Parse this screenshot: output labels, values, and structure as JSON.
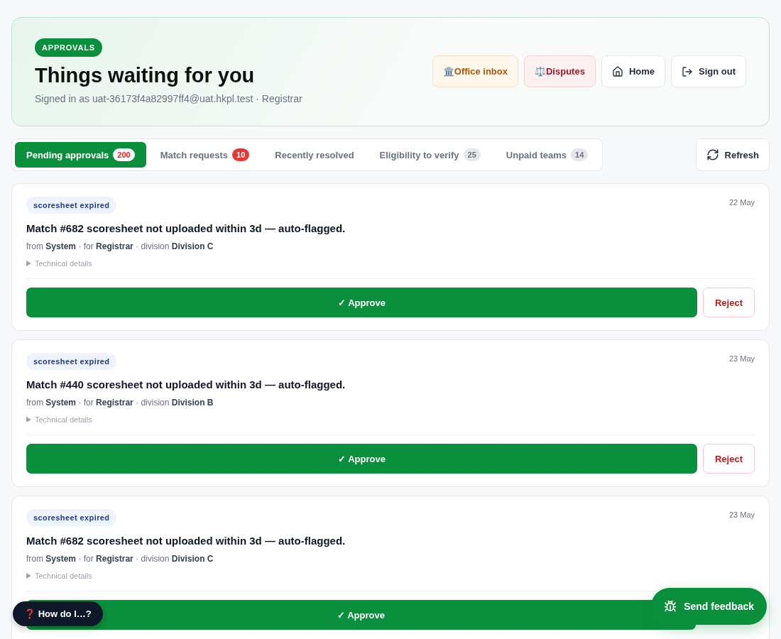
{
  "header": {
    "badge": "APPROVALS",
    "title": "Things waiting for you",
    "subtitle": "Signed in as uat-36173f4a82997ff4@uat.hkpl.test · Registrar"
  },
  "nav": [
    {
      "kind": "office",
      "emoji": "🏛️",
      "label": "Office inbox"
    },
    {
      "kind": "disputes",
      "emoji": "⚖️",
      "label": "Disputes"
    },
    {
      "kind": "home",
      "label": "Home"
    },
    {
      "kind": "signout",
      "label": "Sign out"
    }
  ],
  "tabs": [
    {
      "kind": "alert",
      "label": "Pending approvals",
      "count": "200",
      "selected": true
    },
    {
      "kind": "alert",
      "label": "Match requests",
      "count": "10",
      "selected": false
    },
    {
      "label": "Recently resolved",
      "selected": false
    },
    {
      "kind": "muted",
      "label": "Eligibility to verify",
      "count": "25",
      "selected": false
    },
    {
      "kind": "muted",
      "label": "Unpaid teams",
      "count": "14",
      "selected": false
    }
  ],
  "refresh": "Refresh",
  "items": [
    {
      "tag": "scoresheet expired",
      "date": "22 May",
      "title": "Match #682 scoresheet not uploaded within 3d — auto-flagged.",
      "meta": "from **System** · for **Registrar** · division **Division C**",
      "details": "Technical details",
      "approve": "✓ Approve",
      "reject": "Reject"
    },
    {
      "tag": "scoresheet expired",
      "date": "23 May",
      "title": "Match #440 scoresheet not uploaded within 3d — auto-flagged.",
      "meta": "from **System** · for **Registrar** · division **Division B**",
      "details": "Technical details",
      "approve": "✓ Approve",
      "reject": "Reject"
    },
    {
      "tag": "scoresheet expired",
      "date": "23 May",
      "title": "Match #682 scoresheet not uploaded within 3d — auto-flagged.",
      "meta": "from **System** · for **Registrar** · division **Division C**",
      "details": "Technical details",
      "approve": "✓ Approve"
    }
  ],
  "help": {
    "emoji": "❓",
    "label": "How do I…?"
  },
  "feedback": "Send feedback"
}
